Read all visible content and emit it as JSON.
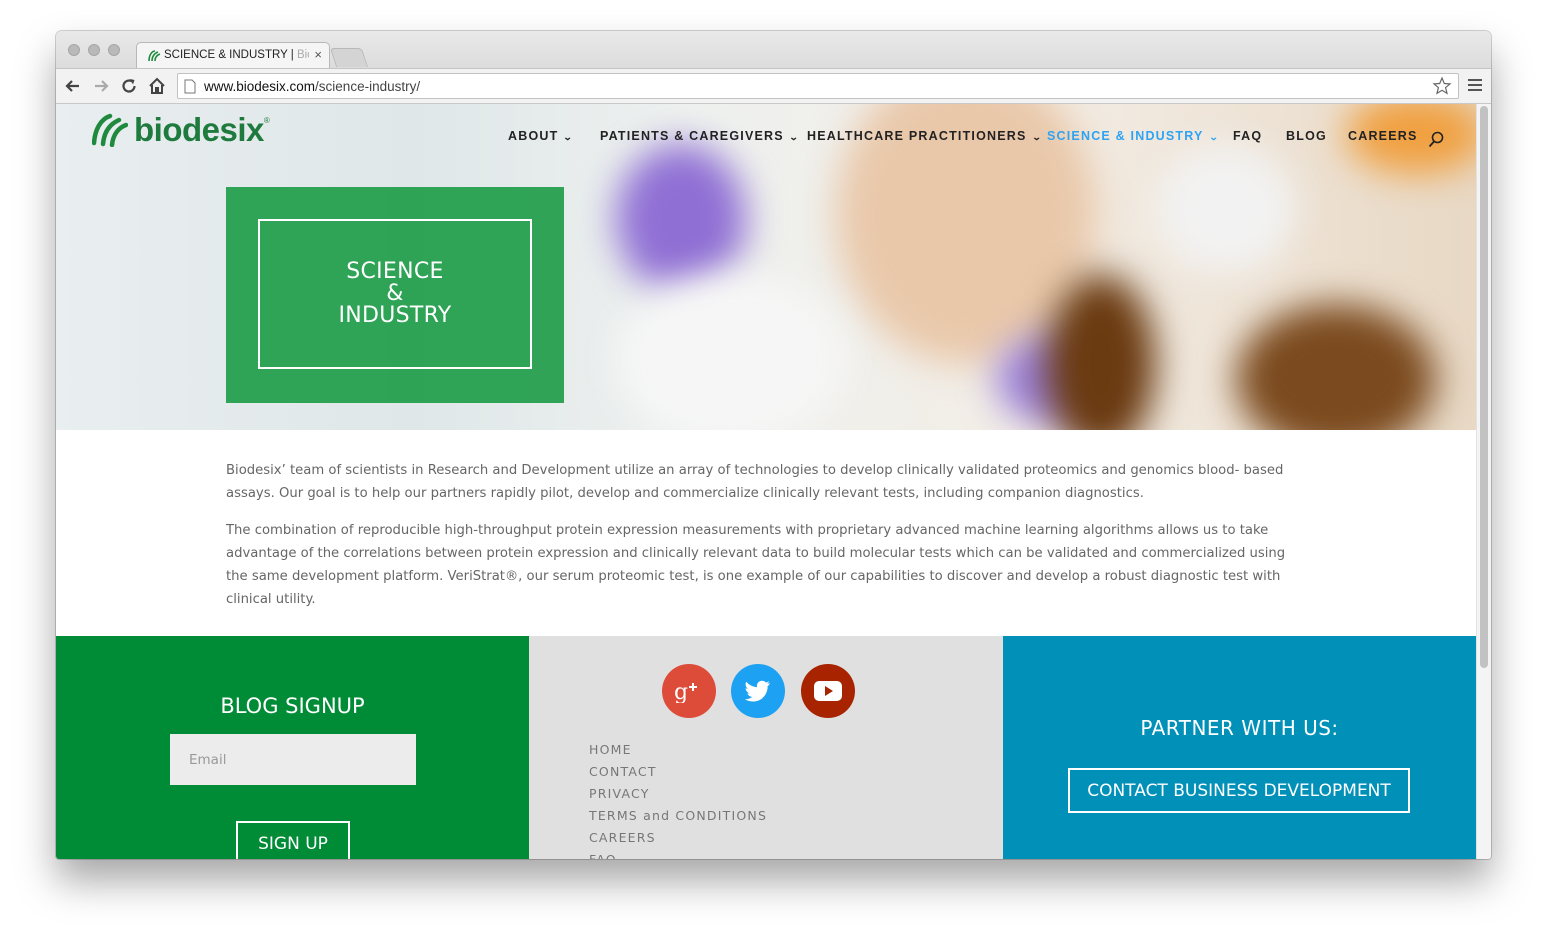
{
  "browser": {
    "tab_title": "SCIENCE & INDUSTRY | ",
    "tab_title_faded": "Bio",
    "url_domain": "www.biodesix.com",
    "url_path": "/science-industry/"
  },
  "site": {
    "logo_text": "biodesix",
    "logo_reg": "®",
    "brand_green": "#008c36",
    "accent_blue": "#2ea3f2",
    "nav": {
      "about": "ABOUT",
      "patients": "PATIENTS & CAREGIVERS",
      "healthcare": "HEALTHCARE PRACTITIONERS",
      "science": "SCIENCE & INDUSTRY",
      "faq": "FAQ",
      "blog": "BLOG",
      "careers": "CAREERS"
    }
  },
  "hero": {
    "line1": "SCIENCE",
    "line2": "&",
    "line3": "INDUSTRY"
  },
  "content": {
    "p1": "Biodesix’ team of scientists in Research and Development utilize an array of technologies to develop clinically validated proteomics and genomics blood- based assays. Our goal is to help our partners rapidly pilot, develop and commercialize clinically relevant tests, including companion diagnostics.",
    "p2": "The combination of reproducible high-throughput protein expression measurements with proprietary advanced machine learning algorithms allows us to take advantage of the correlations between protein expression and clinically relevant data to build molecular tests which can be validated and commercialized using the same development platform. VeriStrat®, our serum proteomic test, is one example of our capabilities to discover and develop a robust diagnostic test with clinical utility."
  },
  "footer": {
    "blog_title": "BLOG SIGNUP",
    "email_placeholder": "Email",
    "signup_label": "SIGN UP",
    "social_icons": [
      "google-plus-icon",
      "twitter-icon",
      "youtube-icon"
    ],
    "social_colors": [
      "#dd4b39",
      "#1da1f2",
      "#a82400"
    ],
    "links": {
      "home": "HOME",
      "contact": "CONTACT",
      "privacy": "PRIVACY",
      "terms": "TERMS and CONDITIONS",
      "careers": "CAREERS",
      "faq": "FAQ"
    },
    "partner_title": "PARTNER WITH US:",
    "contact_btn": "CONTACT BUSINESS DEVELOPMENT"
  }
}
